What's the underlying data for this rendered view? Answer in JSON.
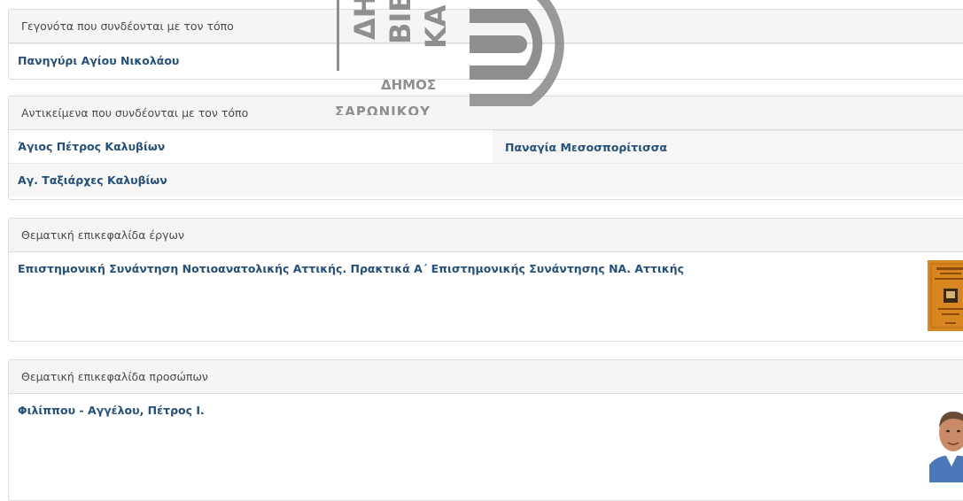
{
  "watermark": {
    "letters": [
      "ΔΗ",
      "ΒΙΒ",
      "ΚΑ"
    ],
    "line1": "ΔΗΜΟΣ",
    "line2": "ΣΑΡΩΝΙΚΟΥ"
  },
  "events": {
    "heading": "Γεγονότα που συνδέονται με τον τόπο",
    "items": [
      "Πανηγύρι Αγίου Νικολάου"
    ]
  },
  "objects": {
    "heading": "Αντικείμενα που συνδέονται με τον τόπο",
    "items": [
      "Άγιος Πέτρος Καλυβίων",
      "Παναγία Μεσοσπορίτισσα",
      "Αγ. Ταξιάρχες Καλυβίων"
    ]
  },
  "works": {
    "heading": "Θεματική επικεφαλίδα έργων",
    "items": [
      "Επιστημονική Συνάντηση Νοτιοανατολικής Αττικής. Πρακτικά Α΄ Επιστημονικής Συνάντησης ΝΑ. Αττικής"
    ]
  },
  "persons": {
    "heading": "Θεματική επικεφαλίδα προσώπων",
    "items": [
      "Φιλίππου - Αγγέλου, Πέτρος Ι."
    ]
  },
  "colors": {
    "link": "#24507a",
    "heading_bg": "#f5f5f5",
    "border": "#dcdcdc",
    "watermark": "#8a8a8a"
  }
}
